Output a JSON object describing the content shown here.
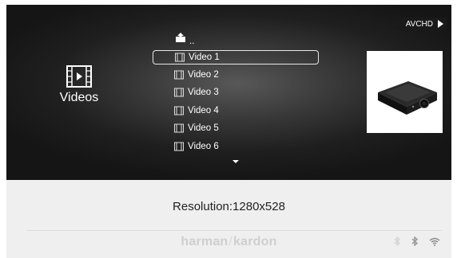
{
  "header": {
    "mode_label": "AVCHD"
  },
  "category": {
    "label": "Videos",
    "icon": "film-icon"
  },
  "list": {
    "up_label": "..",
    "items": [
      {
        "label": "Video 1",
        "selected": true
      },
      {
        "label": "Video 2",
        "selected": false
      },
      {
        "label": "Video 3",
        "selected": false
      },
      {
        "label": "Video 4",
        "selected": false
      },
      {
        "label": "Video 5",
        "selected": false
      },
      {
        "label": "Video 6",
        "selected": false
      }
    ]
  },
  "preview": {
    "icon": "projector-icon"
  },
  "info": {
    "resolution": "Resolution:1280x528"
  },
  "footer": {
    "brand_left": "harman",
    "brand_sep": "/",
    "brand_right": "kardon",
    "status_icons": [
      "bluetooth-icon",
      "bluetooth-icon",
      "wifi-icon"
    ]
  },
  "colors": {
    "screen_bg": "#1f1f1f",
    "panel_bg": "#efefef",
    "text_light": "#ffffff",
    "brand_gray": "#cfcfcf"
  }
}
